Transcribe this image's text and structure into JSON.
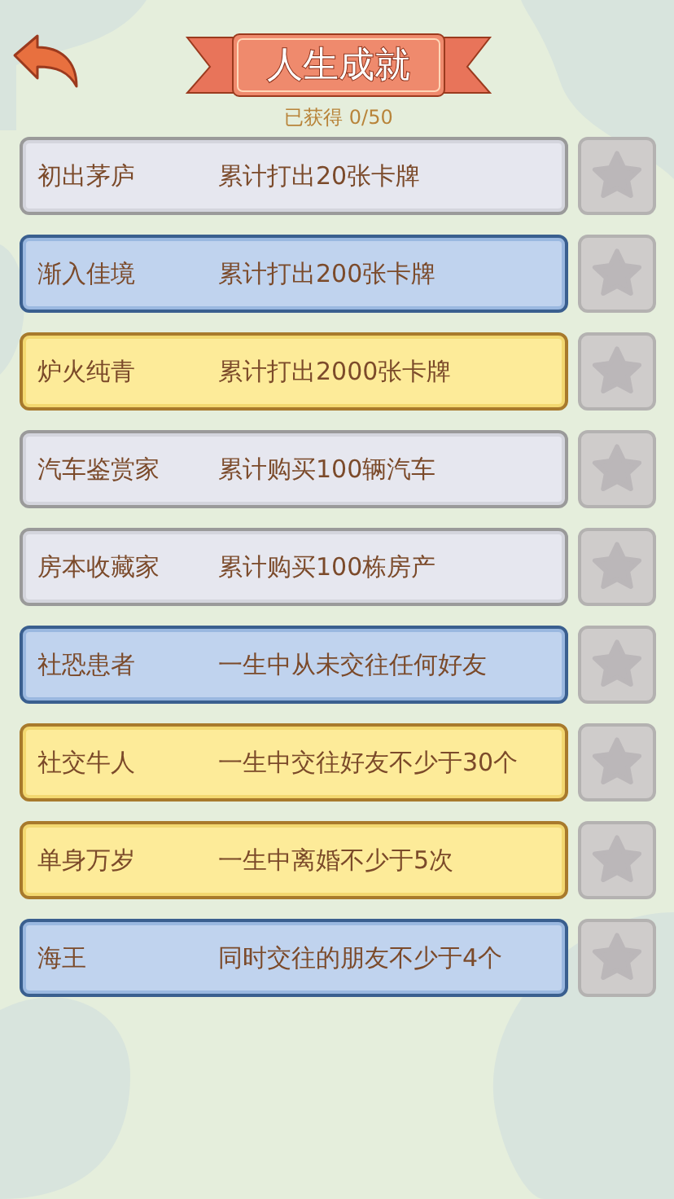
{
  "title": "人生成就",
  "progress": "已获得 0/50",
  "achievements": [
    {
      "name": "初出茅庐",
      "description": "累计打出20张卡牌",
      "color": "#e6e7ef",
      "earned": false
    },
    {
      "name": "渐入佳境",
      "description": "累计打出200张卡牌",
      "color": "#c0d3ee",
      "earned": false
    },
    {
      "name": "炉火纯青",
      "description": "累计打出2000张卡牌",
      "color": "#fdeb99",
      "earned": false
    },
    {
      "name": "汽车鉴赏家",
      "description": "累计购买100辆汽车",
      "color": "#e6e7ef",
      "earned": false
    },
    {
      "name": "房本收藏家",
      "description": "累计购买100栋房产",
      "color": "#e6e7ef",
      "earned": false
    },
    {
      "name": "社恐患者",
      "description": "一生中从未交往任何好友",
      "color": "#c0d3ee",
      "earned": false
    },
    {
      "name": "社交牛人",
      "description": "一生中交往好友不少于30个",
      "color": "#fdeb99",
      "earned": false
    },
    {
      "name": "单身万岁",
      "description": "一生中离婚不少于5次",
      "color": "#fdeb99",
      "earned": false
    },
    {
      "name": "海王",
      "description": "同时交往的朋友不少于4个",
      "color": "#c0d3ee",
      "earned": false
    }
  ]
}
